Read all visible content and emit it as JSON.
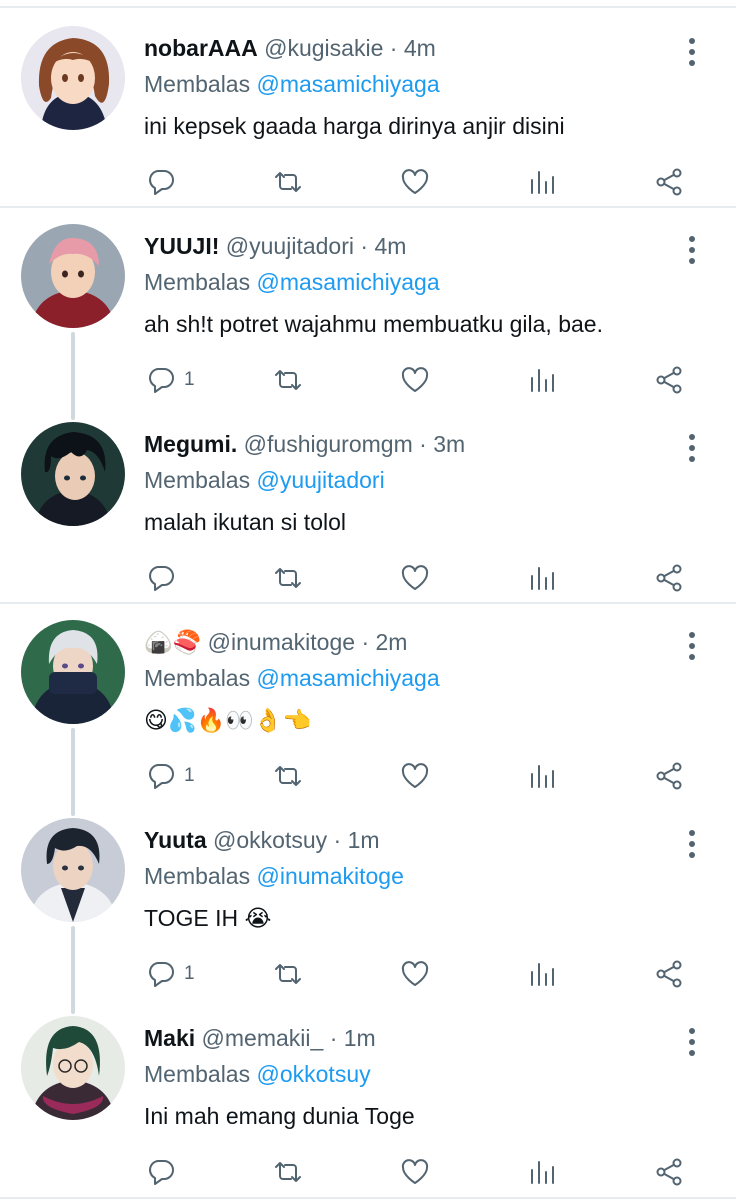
{
  "tweets": [
    {
      "name": "nobarAAA",
      "handle": "@kugisakie",
      "time": "4m",
      "reply_prefix": "Membalas",
      "reply_to": "@masamichiyaga",
      "text": "ini kepsek gaada harga dirinya anjir disini",
      "reply_count": "",
      "avatar": "brown-hair-girl-avatar"
    },
    {
      "name": "YUUJI!",
      "handle": "@yuujitadori",
      "time": "4m",
      "reply_prefix": "Membalas",
      "reply_to": "@masamichiyaga",
      "text": "ah sh!t potret wajahmu membuatku gila, bae.",
      "reply_count": "1",
      "avatar": "pink-hair-boy-avatar"
    },
    {
      "name": "Megumi.",
      "handle": "@fushiguromgm",
      "time": "3m",
      "reply_prefix": "Membalas",
      "reply_to": "@yuujitadori",
      "text": "malah ikutan si tolol",
      "reply_count": "",
      "avatar": "dark-hair-boy-avatar"
    },
    {
      "name": "🍙🍣",
      "handle": "@inumakitoge",
      "time": "2m",
      "reply_prefix": "Membalas",
      "reply_to": "@masamichiyaga",
      "text": "😋💦🔥👀👌👈",
      "reply_count": "1",
      "avatar": "white-hair-mask-avatar"
    },
    {
      "name": "Yuuta",
      "handle": "@okkotsuy",
      "time": "1m",
      "reply_prefix": "Membalas",
      "reply_to": "@inumakitoge",
      "text": "TOGE IH 😭",
      "reply_count": "1",
      "avatar": "black-hair-uniform-avatar"
    },
    {
      "name": "Maki",
      "handle": "@memakii_",
      "time": "1m",
      "reply_prefix": "Membalas",
      "reply_to": "@okkotsuy",
      "text": "Ini mah emang dunia Toge",
      "reply_count": "",
      "avatar": "green-hair-glasses-avatar"
    }
  ],
  "dot": "·",
  "colors": {
    "link": "#1d9bf0",
    "muted": "#536471",
    "divider": "#e6ecf0",
    "thread": "#cfd9de"
  }
}
